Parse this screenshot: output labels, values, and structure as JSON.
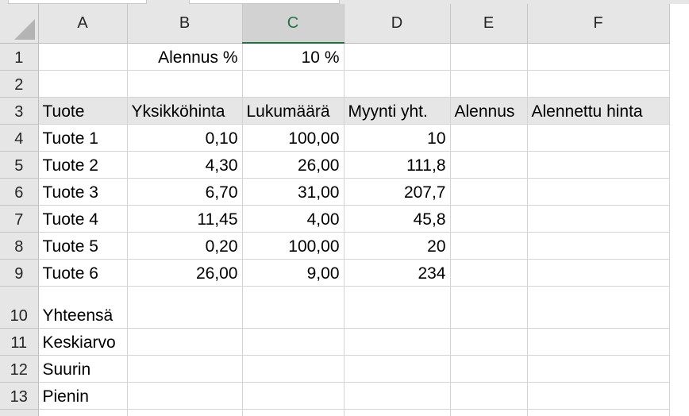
{
  "columns": [
    "A",
    "B",
    "C",
    "D",
    "E",
    "F"
  ],
  "selected_column": "C",
  "rows": [
    {
      "num": "1",
      "cells": [
        "",
        "Alennus %",
        "10 %",
        "",
        "",
        ""
      ]
    },
    {
      "num": "2",
      "cells": [
        "",
        "",
        "",
        "",
        "",
        ""
      ]
    },
    {
      "num": "3",
      "cells": [
        "Tuote",
        "Yksikköhinta",
        "Lukumäärä",
        "Myynti yht.",
        "Alennus",
        "Alennettu hinta"
      ]
    },
    {
      "num": "4",
      "cells": [
        "Tuote 1",
        "0,10",
        "100,00",
        "10",
        "",
        ""
      ]
    },
    {
      "num": "5",
      "cells": [
        "Tuote 2",
        "4,30",
        "26,00",
        "111,8",
        "",
        ""
      ]
    },
    {
      "num": "6",
      "cells": [
        "Tuote 3",
        "6,70",
        "31,00",
        "207,7",
        "",
        ""
      ]
    },
    {
      "num": "7",
      "cells": [
        "Tuote 4",
        "11,45",
        "4,00",
        "45,8",
        "",
        ""
      ]
    },
    {
      "num": "8",
      "cells": [
        "Tuote 5",
        "0,20",
        "100,00",
        "20",
        "",
        ""
      ]
    },
    {
      "num": "9",
      "cells": [
        "Tuote 6",
        "26,00",
        "9,00",
        "234",
        "",
        ""
      ]
    },
    {
      "num": "10",
      "cells": [
        "Yhteensä",
        "",
        "",
        "",
        "",
        ""
      ]
    },
    {
      "num": "11",
      "cells": [
        "Keskiarvo",
        "",
        "",
        "",
        "",
        ""
      ]
    },
    {
      "num": "12",
      "cells": [
        "Suurin",
        "",
        "",
        "",
        "",
        ""
      ]
    },
    {
      "num": "13",
      "cells": [
        "Pienin",
        "",
        "",
        "",
        "",
        ""
      ]
    }
  ],
  "colors": {
    "accent": "#217346",
    "header_fill": "#e7e6e6",
    "heading_bg": "#e6e6e6"
  }
}
